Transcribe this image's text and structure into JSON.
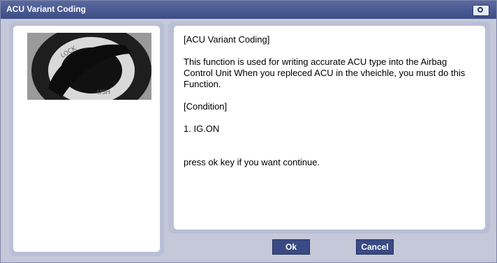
{
  "window": {
    "title": "ACU Variant Coding"
  },
  "message": {
    "heading": "[ACU Variant Coding]",
    "description": "This function is used for writing accurate ACU type into the Airbag Control Unit When you repleced ACU in the vheichle, you must do this Function.",
    "condition_heading": "[Condition]",
    "condition_item": "1. IG.ON",
    "prompt": "press ok key  if you want continue."
  },
  "buttons": {
    "ok": "Ok",
    "cancel": "Cancel"
  },
  "image": {
    "icon": "ignition-key-icon"
  }
}
